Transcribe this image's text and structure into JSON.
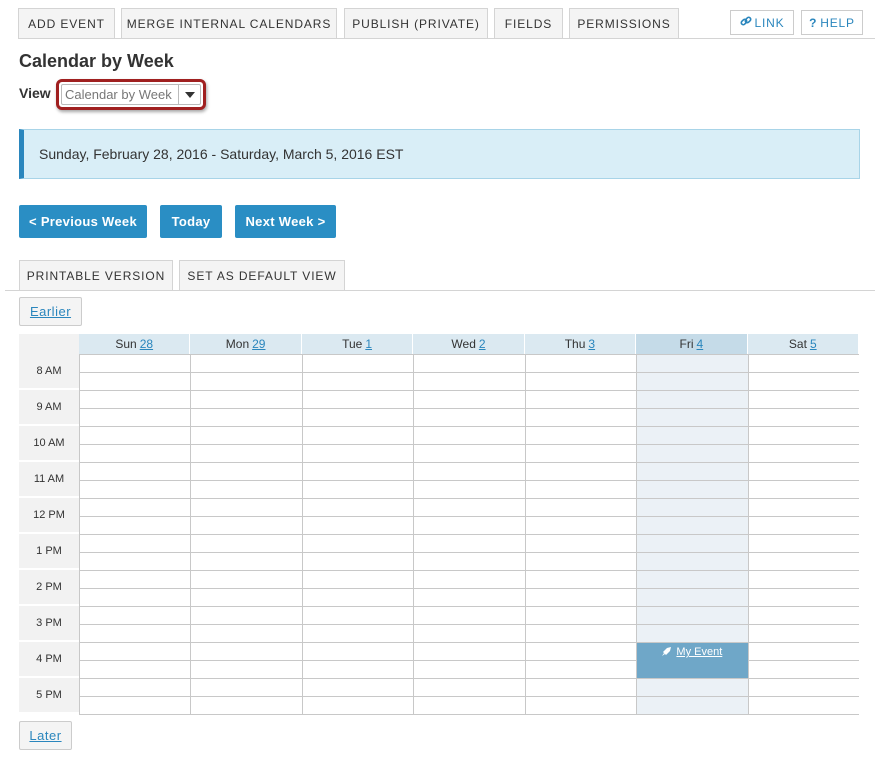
{
  "toolbar": {
    "tabs": [
      "ADD EVENT",
      "MERGE INTERNAL CALENDARS",
      "PUBLISH (PRIVATE)",
      "FIELDS",
      "PERMISSIONS"
    ],
    "link_label": "LINK",
    "help_label": "HELP",
    "help_glyph": "?"
  },
  "page": {
    "title": "Calendar by Week",
    "view_label": "View",
    "view_value": "Calendar by Week"
  },
  "banner": {
    "text": "Sunday, February 28, 2016 - Saturday, March 5, 2016 EST"
  },
  "nav": {
    "previous": "< Previous Week",
    "today": "Today",
    "next": "Next Week >"
  },
  "subtabs": [
    "PRINTABLE VERSION",
    "SET AS DEFAULT VIEW"
  ],
  "pager": {
    "earlier": "Earlier",
    "later": "Later"
  },
  "calendar": {
    "days": [
      {
        "name": "Sun",
        "date": "28"
      },
      {
        "name": "Mon",
        "date": "29"
      },
      {
        "name": "Tue",
        "date": "1"
      },
      {
        "name": "Wed",
        "date": "2"
      },
      {
        "name": "Thu",
        "date": "3"
      },
      {
        "name": "Fri",
        "date": "4"
      },
      {
        "name": "Sat",
        "date": "5"
      }
    ],
    "today_day": "Fri",
    "hours": [
      "8 AM",
      "9 AM",
      "10 AM",
      "11 AM",
      "12 PM",
      "1 PM",
      "2 PM",
      "3 PM",
      "4 PM",
      "5 PM"
    ],
    "event": {
      "title": "My Event",
      "day": "Fri",
      "start_hour": "4 PM"
    }
  },
  "colors": {
    "accent": "#2a8ec4",
    "banner_bg": "#d9eef7",
    "today_col": "#ebf1f6",
    "event_bg": "#6fa7c8",
    "highlight_border": "#a02020"
  }
}
